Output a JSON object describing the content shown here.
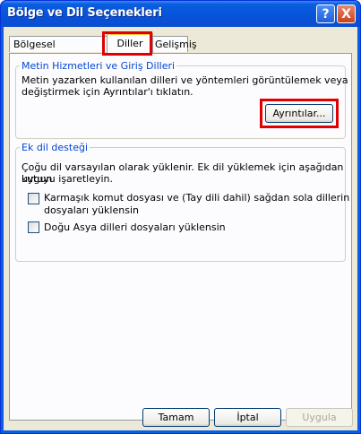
{
  "window": {
    "title": "Bölge ve Dil Seçenekleri",
    "help_icon": "?",
    "close_icon": "X"
  },
  "tabs": [
    {
      "label": "Bölgesel Seçenekler",
      "selected": false
    },
    {
      "label": "Diller",
      "selected": true
    },
    {
      "label": "Gelişmiş",
      "selected": false
    }
  ],
  "text_services": {
    "group_label": "Metin Hizmetleri ve Giriş Dilleri",
    "description_line1": "Metin yazarken kullanılan dilleri ve yöntemleri görüntülemek veya",
    "description_line2": "değiştirmek için Ayrıntılar'ı tıklatın.",
    "details_button": "Ayrıntılar..."
  },
  "supplemental": {
    "group_label": "Ek dil desteği",
    "description_line1": "Çoğu dil varsayılan olarak yüklenir. Ek dil yüklemek için aşağıdan uygun",
    "description_line2": "kutuyu işaretleyin.",
    "complex_script": {
      "line1": "Karmaşık komut dosyası ve (Tay dili dahil) sağdan sola dillerin",
      "line2": "dosyaları yüklensin",
      "checked": false
    },
    "east_asian": {
      "label": "Doğu Asya dilleri dosyaları yüklensin",
      "checked": false
    }
  },
  "buttons": {
    "ok": "Tamam",
    "cancel": "İptal",
    "apply": "Uygula"
  },
  "colors": {
    "highlight": "#e00000",
    "titlebar": "#0a5fe0",
    "group_label": "#0046d5"
  }
}
